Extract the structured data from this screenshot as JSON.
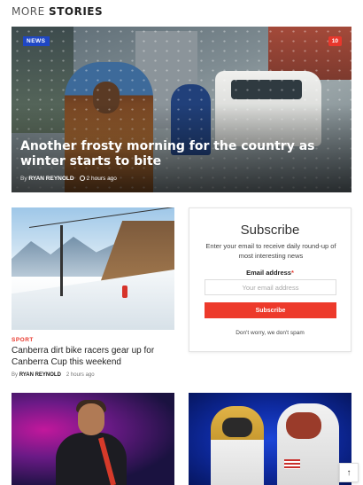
{
  "section": {
    "title_light": "MORE",
    "title_bold": "STORIES"
  },
  "hero": {
    "category": "NEWS",
    "count": "10",
    "title": "Another frosty morning for the country as winter starts to bite",
    "by": "By",
    "author": "RYAN REYNOLD",
    "time": "2 hours ago"
  },
  "story2": {
    "category": "SPORT",
    "title": "Canberra dirt bike racers gear up for Canberra Cup this weekend",
    "by": "By",
    "author": "RYAN REYNOLD",
    "time": "2 hours ago"
  },
  "subscribe": {
    "title": "Subscribe",
    "description": "Enter your email to receive daily round-up of most interesting news",
    "email_label": "Email address",
    "required_mark": "*",
    "email_placeholder": "Your email address",
    "button_label": "Subscribe",
    "note": "Don't worry, we don't spam"
  },
  "back_to_top": {
    "icon": "arrow-up-icon",
    "glyph": "↑"
  },
  "colors": {
    "accent": "#e8372c",
    "badge_blue": "#1f47c4"
  }
}
